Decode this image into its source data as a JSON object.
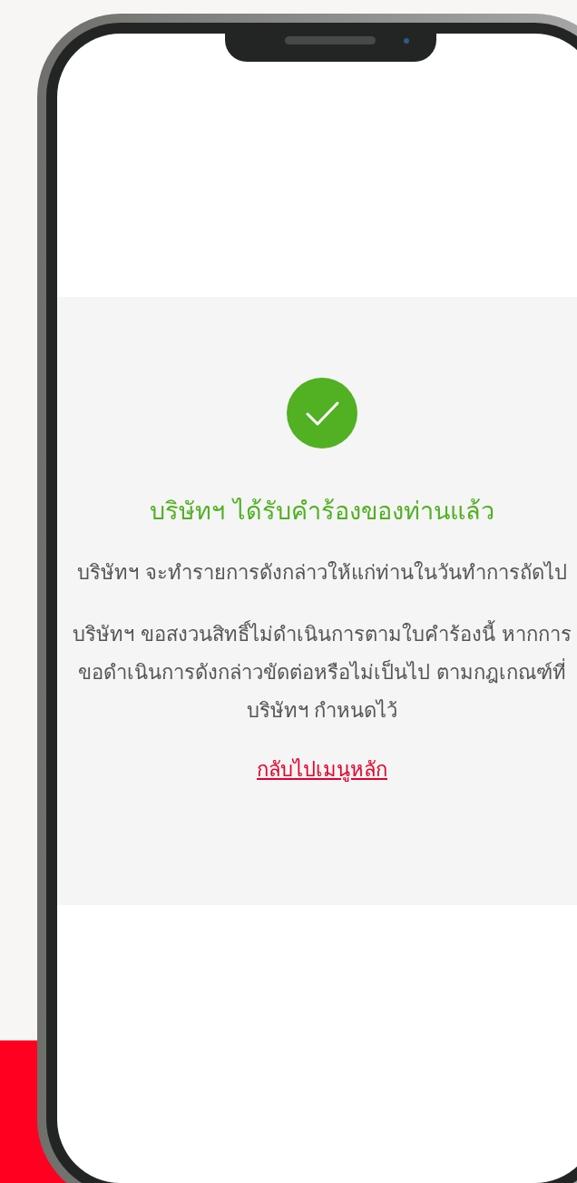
{
  "confirmation": {
    "title": "บริษัทฯ ได้รับคำร้องของท่านแล้ว",
    "paragraphs": [
      "บริษัทฯ จะทำรายการดังกล่าวให้แก่ท่านในวันทำการถัดไป",
      "บริษัทฯ ขอสงวนสิทธิ์ไม่ดำเนินการตามใบคำร้องนี้ หากการขอดำเนินการดังกล่าวขัดต่อหรือไม่เป็นไป ตามกฎเกณฑ์ที่บริษัทฯ กำหนดไว้"
    ],
    "link": "กลับไปเมนูหลัก"
  }
}
